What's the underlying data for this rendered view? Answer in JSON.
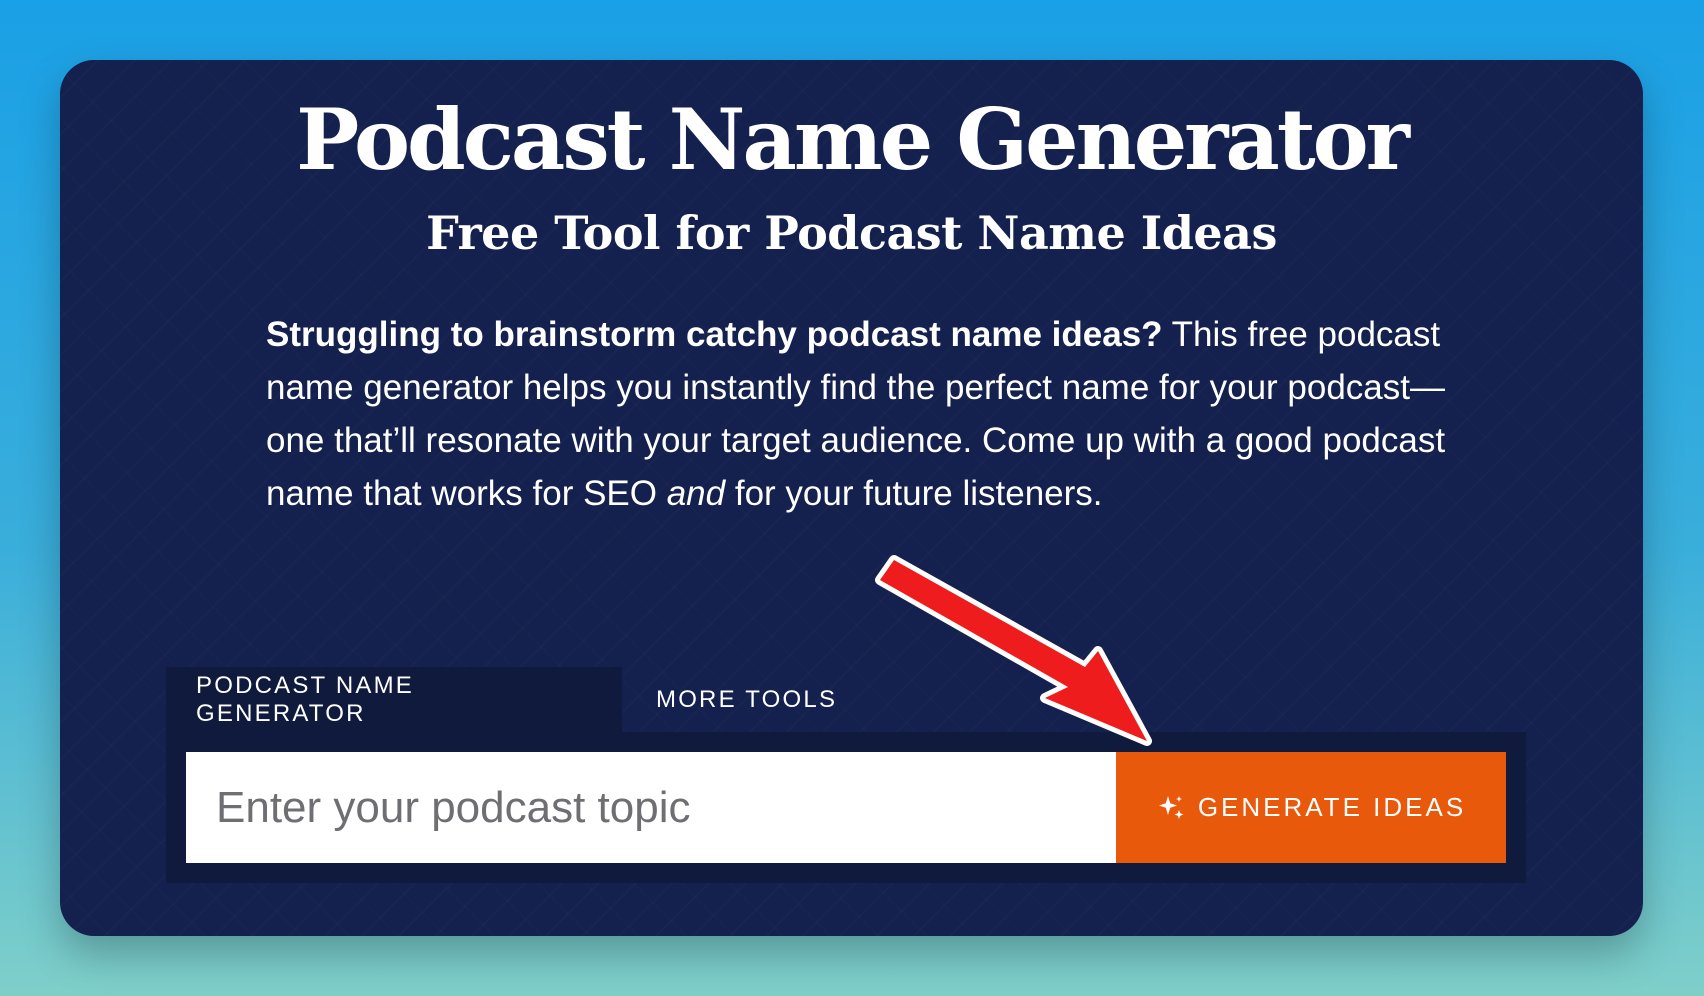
{
  "header": {
    "title": "Podcast Name Generator",
    "subtitle": "Free Tool for Podcast Name Ideas"
  },
  "description": {
    "bold_lead": "Struggling to brainstorm catchy podcast name ideas?",
    "text_1": " This free podcast name generator helps you instantly find the perfect name for your podcast—one that’ll resonate with your target audience. Come up with a good podcast name that works for SEO ",
    "italic_word": "and",
    "text_2": " for your future listeners."
  },
  "tabs": [
    {
      "label": "PODCAST NAME GENERATOR",
      "active": true
    },
    {
      "label": "MORE TOOLS",
      "active": false
    }
  ],
  "search": {
    "placeholder": "Enter your podcast topic",
    "value": ""
  },
  "generate_button": {
    "label": "GENERATE IDEAS",
    "icon": "sparkle-icon"
  },
  "annotation": {
    "icon": "red-arrow-icon",
    "color": "#ee1c1c"
  },
  "colors": {
    "background_top": "#1aa0e6",
    "card": "#14204d",
    "panel": "#0f1a3c",
    "button": "#e8590c",
    "text": "#ffffff"
  }
}
